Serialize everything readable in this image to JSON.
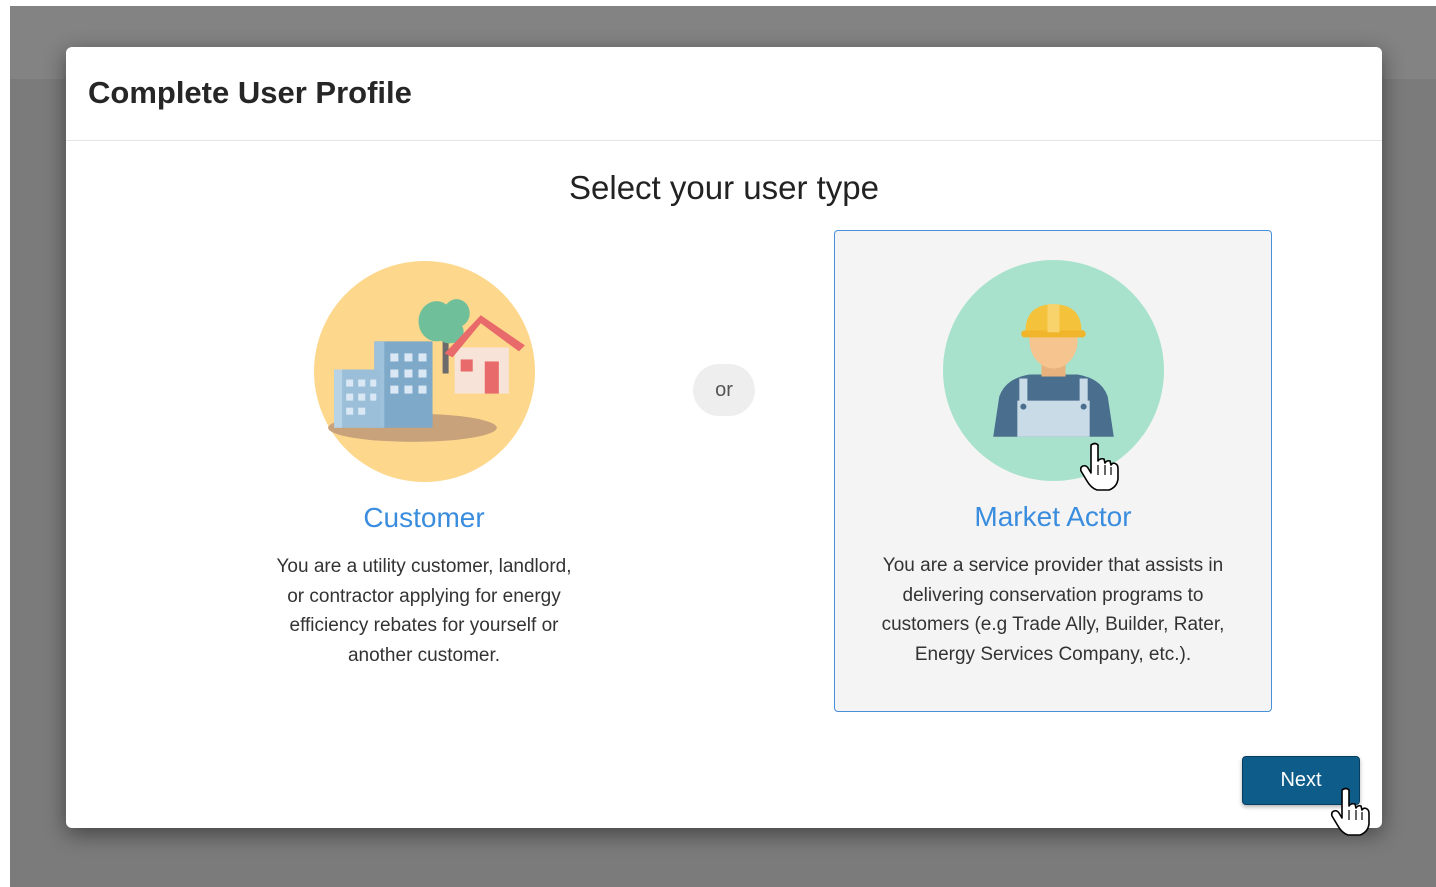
{
  "modal": {
    "title": "Complete User Profile",
    "subtitle": "Select your user type"
  },
  "options": [
    {
      "title": "Customer",
      "description": "You are a utility customer, landlord, or contractor applying for energy efficiency rebates for yourself or another customer.",
      "icon": "customer-buildings-icon",
      "circle_color": "#fdd88c",
      "selected": false
    },
    {
      "title": "Market Actor",
      "description": "You are a service provider that assists in delivering conservation programs to customers (e.g Trade Ally, Builder, Rater, Energy Services Company, etc.).",
      "icon": "worker-hardhat-icon",
      "circle_color": "#a8e2cc",
      "selected": true
    }
  ],
  "separator": "or",
  "footer": {
    "next_label": "Next"
  },
  "colors": {
    "accent_link": "#3a8dde",
    "primary_button": "#0d5c8a",
    "selected_border": "#4a90d9"
  }
}
